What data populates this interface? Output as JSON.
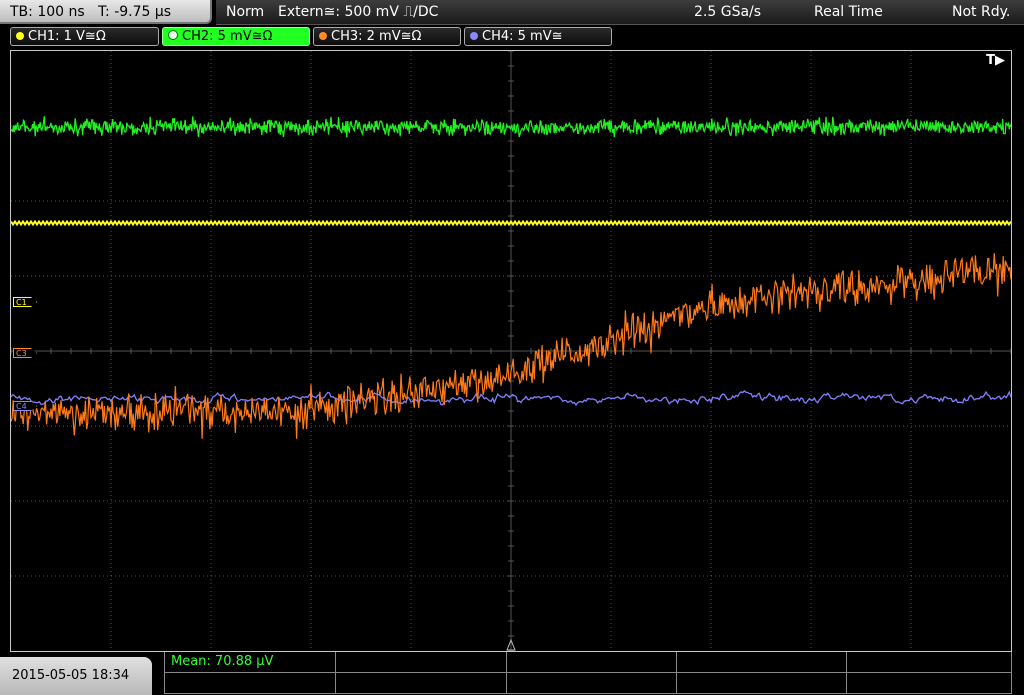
{
  "timebase": {
    "tb": "TB: 100 ns",
    "trigger_time": "T: -9.75 µs"
  },
  "status": {
    "mode": "Norm",
    "trigger_source": "Extern≅: 500 mV ⎍/DC",
    "sample_rate": "2.5 GSa/s",
    "acquisition": "Real Time",
    "state": "Not Rdy."
  },
  "channels": [
    {
      "label": "CH1: 1 V≅Ω",
      "color": "#ffff22",
      "active": false
    },
    {
      "label": "CH2: 5 mV≅Ω",
      "color": "#22ff22",
      "active": true
    },
    {
      "label": "CH3: 2 mV≅Ω",
      "color": "#ff8c2a",
      "active": false
    },
    {
      "label": "CH4: 5 mV≅",
      "color": "#8888ff",
      "active": false
    }
  ],
  "markers": {
    "c1": "C1",
    "c3": "C3",
    "c4": "C4"
  },
  "trigger_indicator": "T▶",
  "datetime": "2015-05-05 18:34",
  "measurement": {
    "mean": "Mean: 70.88 µV"
  },
  "colors": {
    "ch1": "#ffff22",
    "ch2": "#22ee22",
    "ch3": "#ff7a1a",
    "ch4": "#8080ff",
    "grid": "#555555"
  }
}
